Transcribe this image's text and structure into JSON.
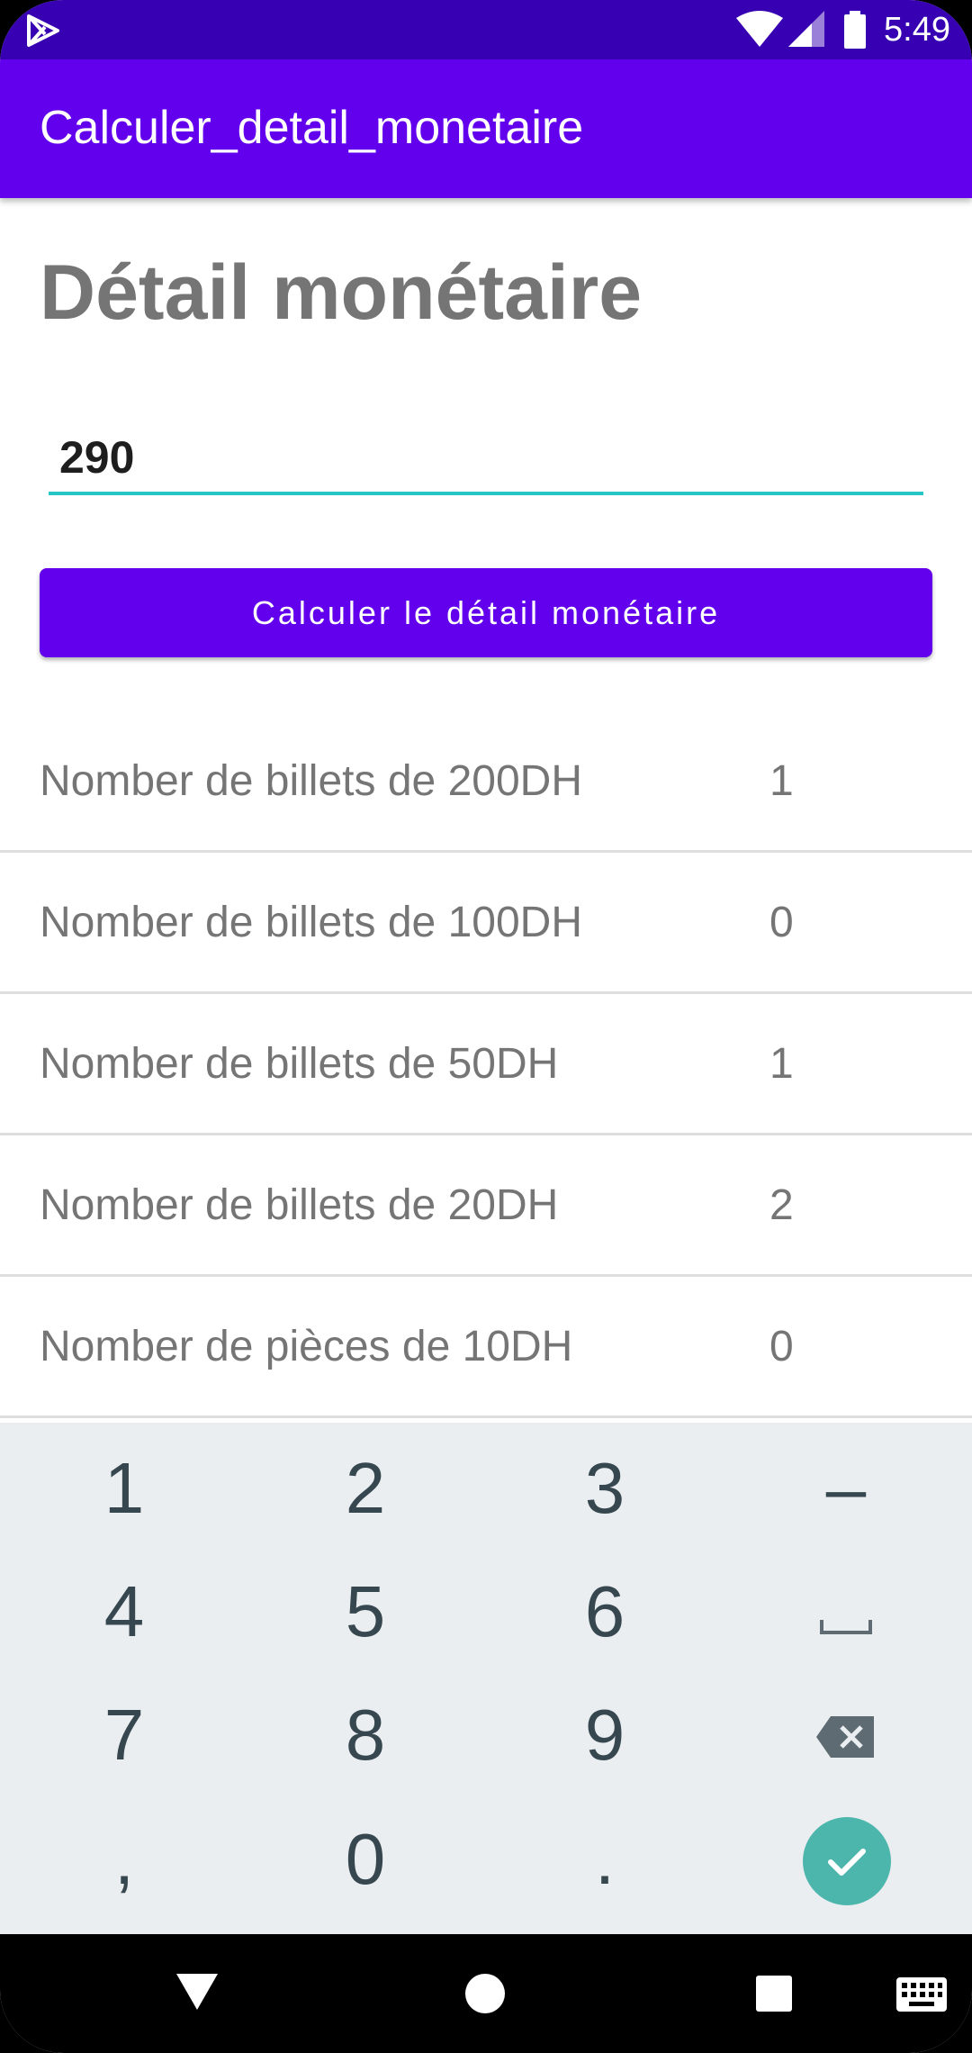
{
  "status_bar": {
    "time": "5:49"
  },
  "app_bar": {
    "title": "Calculer_detail_monetaire"
  },
  "main": {
    "heading": "Détail monétaire",
    "amount_input": {
      "value": "290"
    },
    "calc_button_label": "Calculer le détail monétaire",
    "results": [
      {
        "label": "Nomber de billets de 200DH",
        "value": "1"
      },
      {
        "label": "Nomber de billets de 100DH",
        "value": "0"
      },
      {
        "label": "Nomber de billets de 50DH",
        "value": "1"
      },
      {
        "label": "Nomber de billets de 20DH",
        "value": "2"
      },
      {
        "label": "Nomber de pièces de 10DH",
        "value": "0"
      }
    ]
  },
  "keyboard": {
    "keys": [
      "1",
      "2",
      "3",
      "–",
      "4",
      "5",
      "6",
      "7",
      "8",
      "9",
      ",",
      "0",
      "."
    ],
    "special_keys": [
      "space-icon",
      "backspace-icon",
      "check-icon"
    ]
  },
  "nav_bar": {
    "buttons": [
      "back-icon",
      "home-icon",
      "recents-icon",
      "keyboard-icon"
    ]
  },
  "colors": {
    "primary": "#6200ee",
    "primary_dark": "#3700b3",
    "accent": "#26c6c6",
    "confirm": "#4db6ac"
  }
}
